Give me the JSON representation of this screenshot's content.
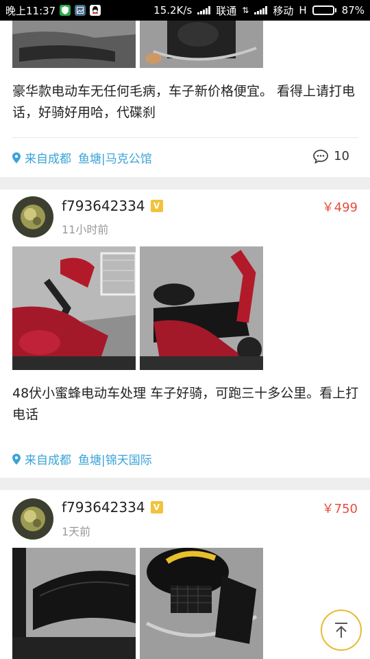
{
  "status_bar": {
    "time": "晚上11:37",
    "speed": "15.2K/s",
    "carrier1": "联通",
    "carrier2": "移动",
    "network": "H",
    "battery": "87%",
    "battery_level": 0.87
  },
  "posts": [
    {
      "description": "豪华款电动车无任何毛病，车子新价格便宜。 看得上请打电话，好骑好用哈，代碟刹",
      "location_from": "来自成都",
      "location_place": "鱼塘|马克公馆",
      "comment_count": "10",
      "comment_icon": "comment-icon"
    },
    {
      "username": "f793642334",
      "verified": "V",
      "time": "11小时前",
      "price": "￥499",
      "description": "48伏小蜜蜂电动车处理 车子好骑，可跑三十多公里。看上打电话",
      "location_from": "来自成都",
      "location_place": "鱼塘|锦天国际"
    },
    {
      "username": "f793642334",
      "verified": "V",
      "time": "1天前",
      "price": "￥750"
    }
  ],
  "icons": {
    "location": "location-pin-icon",
    "back_to_top": "arrow-up-icon"
  },
  "colors": {
    "accent_blue": "#3aa3d8",
    "price_red": "#e84b3c",
    "badge_gold": "#f2c23a"
  }
}
